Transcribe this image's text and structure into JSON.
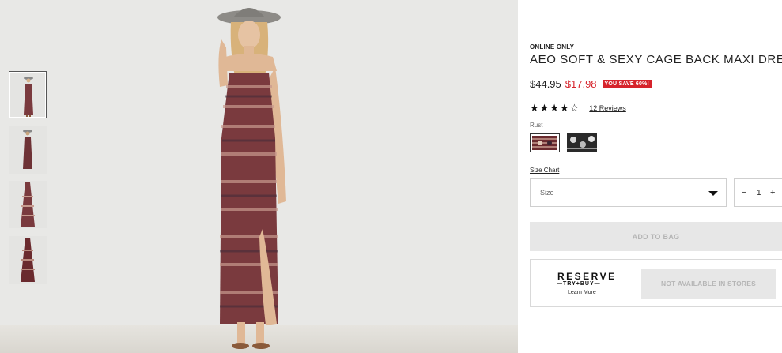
{
  "product": {
    "online_label": "ONLINE ONLY",
    "title": "AEO SOFT & SEXY CAGE BACK MAXI DRESS",
    "original_price": "$44.95",
    "sale_price": "$17.98",
    "save_badge": "YOU SAVE 60%!",
    "rating": 4,
    "stars": "★★★★☆",
    "reviews_link": "12 Reviews",
    "color_label": "Rust",
    "swatches": [
      {
        "name": "rust",
        "color": "#6a2a2e",
        "selected": true
      },
      {
        "name": "black-print",
        "color": "#2a2a2a",
        "selected": false
      }
    ],
    "size_chart_link": "Size Chart",
    "size_placeholder": "Size",
    "quantity": {
      "minus": "−",
      "value": "1",
      "plus": "+"
    },
    "add_to_bag": "ADD TO BAG",
    "reserve": {
      "logo_main": "RESERVE",
      "logo_sub": "—TRY+BUY—",
      "learn_more": "Learn More",
      "status": "NOT AVAILABLE IN STORES"
    }
  },
  "gallery": {
    "thumbnail_count": 4,
    "selected_index": 0
  }
}
